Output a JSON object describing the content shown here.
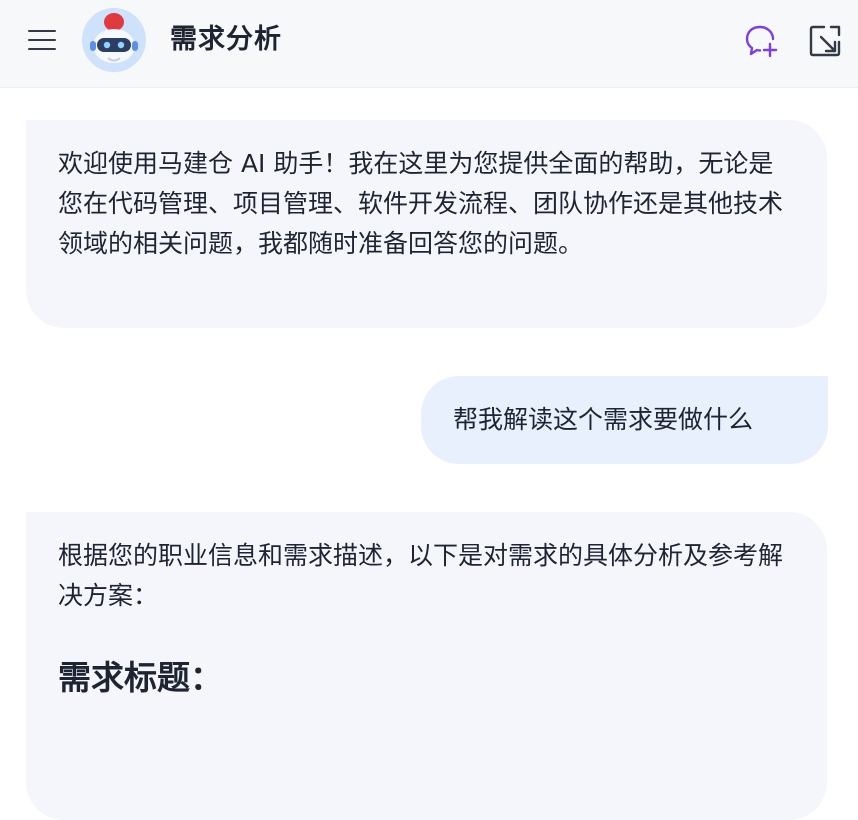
{
  "header": {
    "title": "需求分析",
    "icons": [
      "menu-icon",
      "robot-avatar",
      "new-chat-icon",
      "exit-icon"
    ]
  },
  "messages": [
    {
      "role": "assistant",
      "text": "欢迎使用马建仓 AI 助手！我在这里为您提供全面的帮助，无论是您在代码管理、项目管理、软件开发流程、团队协作还是其他技术领域的相关问题，我都随时准备回答您的问题。"
    },
    {
      "role": "user",
      "text": "帮我解读这个需求要做什么"
    },
    {
      "role": "assistant",
      "text": "根据您的职业信息和需求描述，以下是对需求的具体分析及参考解决方案：",
      "heading": "需求标题："
    }
  ],
  "colors": {
    "header_bg": "#f7f8fa",
    "assistant_bubble": "#f4f6fb",
    "user_bubble": "#e8effd",
    "accent_purple": "#7b3fe4",
    "text": "#1f2433"
  }
}
